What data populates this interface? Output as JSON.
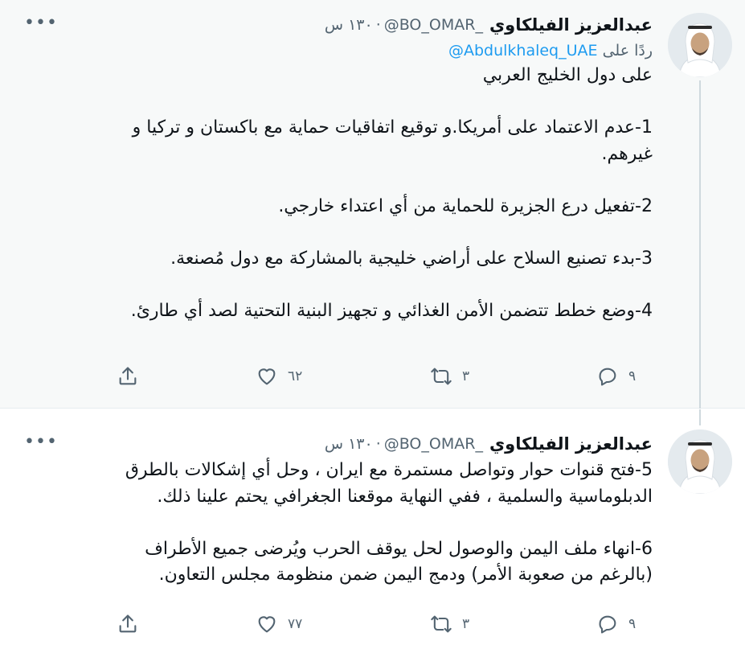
{
  "tweets": [
    {
      "name": "عبدالعزيز الفيلكاوي",
      "handle": "@BO_OMAR_",
      "time": "١٣٠ س",
      "more": "•••",
      "replying_prefix": "ردًا على",
      "replying_to": "@Abdulkhaleq_UAE",
      "lines": [
        "على دول الخليج العربي",
        "",
        "1-عدم الاعتماد على أمريكا.و توقيع اتفاقيات حماية مع باكستان و تركيا و",
        "غيرهم.",
        "",
        "2-تفعيل درع الجزيرة للحماية من أي اعتداء خارجي.",
        "",
        "3-بدء تصنيع السلاح على أراضي خليجية بالمشاركة مع دول مُصنعة.",
        "",
        "4-وضع خطط تتضمن الأمن الغذائي و تجهيز البنية التحتية لصد أي طارئ."
      ],
      "replies": "٩",
      "retweets": "٣",
      "likes": "٦٢"
    },
    {
      "name": "عبدالعزيز الفيلكاوي",
      "handle": "@BO_OMAR_",
      "time": "١٣٠ س",
      "more": "•••",
      "lines": [
        "5-فتح قنوات حوار وتواصل مستمرة مع ايران ، وحل أي إشكالات بالطرق",
        "الدبلوماسية والسلمية ، ففي النهاية موقعنا الجغرافي يحتم علينا ذلك.",
        "",
        "6-انهاء ملف اليمن والوصول لحل يوقف الحرب ويُرضى جميع الأطراف",
        "(بالرغم من صعوبة الأمر) ودمج اليمن ضمن منظومة مجلس التعاون."
      ],
      "replies": "٩",
      "retweets": "٣",
      "likes": "٧٧"
    }
  ],
  "icons": {
    "reply": "reply-icon",
    "retweet": "retweet-icon",
    "like": "like-icon",
    "share": "share-icon",
    "more": "more-icon"
  },
  "colors": {
    "text": "#0f1419",
    "secondary": "#536471",
    "link": "#1d9bf0",
    "highlight_bg": "#f7f9f9"
  }
}
